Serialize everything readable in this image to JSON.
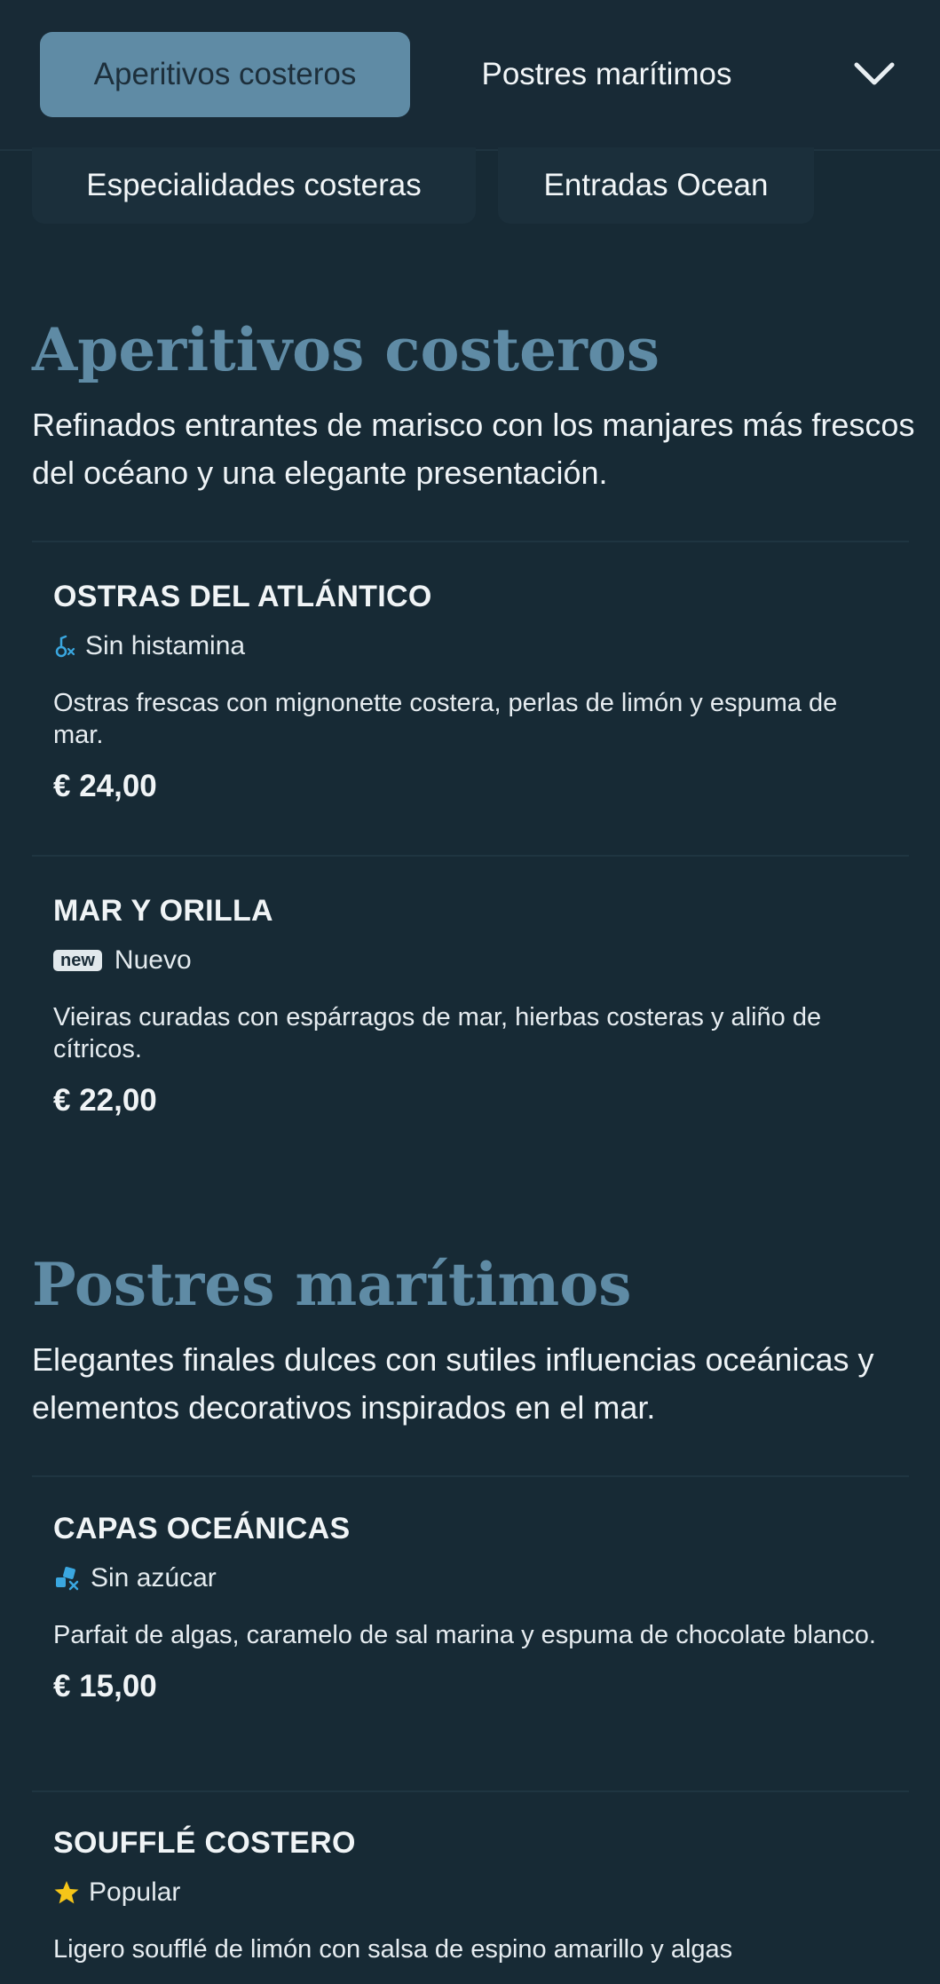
{
  "nav": {
    "tabs": [
      {
        "label": "Aperitivos costeros",
        "active": true
      },
      {
        "label": "Postres marítimos",
        "active": false
      },
      {
        "label": "Especialidades costeras",
        "active": false
      },
      {
        "label": "Entradas Ocean",
        "active": false
      }
    ],
    "toggle_icon": "chevron-down-icon"
  },
  "sections": [
    {
      "title": "Aperitivos costeros",
      "description": "Refinados entrantes de marisco con los manjares más frescos del océano y una elegante presentación.",
      "items": [
        {
          "name": "OSTRAS DEL ATLÁNTICO",
          "tag": {
            "icon": "histamine-free-icon",
            "label": "Sin histamina"
          },
          "description": "Ostras frescas con mignonette costera, perlas de limón y espuma de mar.",
          "price": "€ 24,00"
        },
        {
          "name": "MAR Y ORILLA",
          "tag": {
            "badge": "new",
            "label": "Nuevo"
          },
          "description": "Vieiras curadas con espárragos de mar, hierbas costeras y aliño de cítricos.",
          "price": "€ 22,00"
        }
      ]
    },
    {
      "title": "Postres marítimos",
      "description": "Elegantes finales dulces con sutiles influencias oceánicas y elementos decorativos inspirados en el mar.",
      "items": [
        {
          "name": "CAPAS OCEÁNICAS",
          "tag": {
            "icon": "sugar-free-icon",
            "label": "Sin azúcar"
          },
          "description": "Parfait de algas, caramelo de sal marina y espuma de chocolate blanco.",
          "price": "€ 15,00"
        },
        {
          "name": "SOUFFLÉ COSTERO",
          "tag": {
            "icon": "star-icon",
            "label": "Popular"
          },
          "description": "Ligero soufflé de limón con salsa de espino amarillo y algas",
          "price": ""
        }
      ]
    }
  ],
  "colors": {
    "background": "#172a35",
    "accent": "#5f8ba5",
    "icon_blue": "#3aa7e0",
    "star": "#f5c518"
  }
}
